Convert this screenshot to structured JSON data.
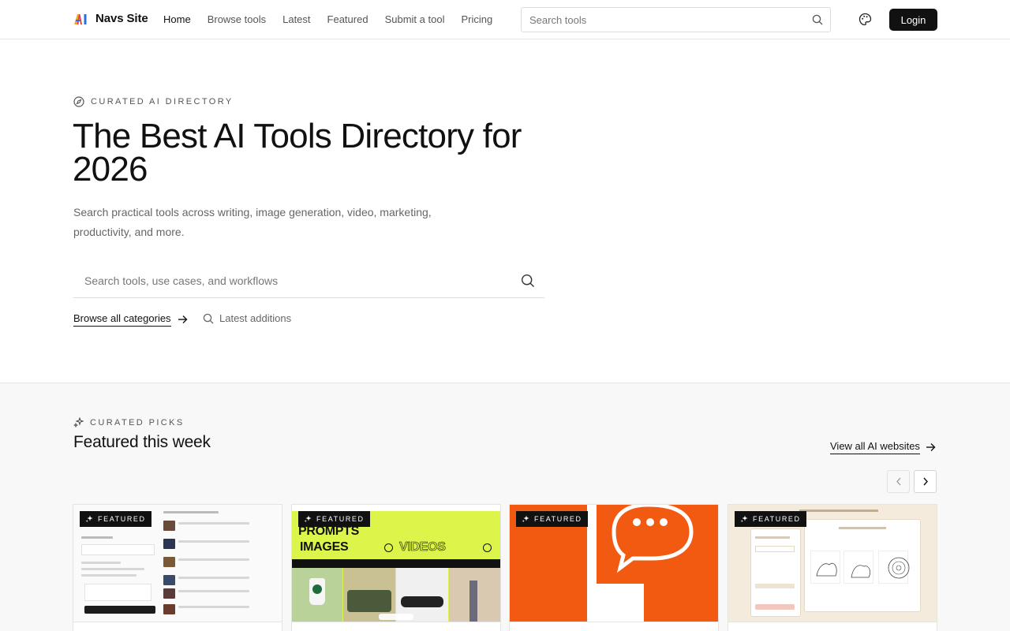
{
  "header": {
    "logo_text": "Navs Site",
    "nav": [
      "Home",
      "Browse tools",
      "Latest",
      "Featured",
      "Submit a tool",
      "Pricing"
    ],
    "active_nav": "Home",
    "search_placeholder": "Search tools",
    "login_label": "Login"
  },
  "hero": {
    "eyebrow": "CURATED AI DIRECTORY",
    "title": "The Best AI Tools Directory for 2026",
    "subtitle": "Search practical tools across writing, image generation, video, marketing, productivity, and more.",
    "search_placeholder": "Search tools, use cases, and workflows",
    "browse_label": "Browse all categories",
    "latest_label": "Latest additions"
  },
  "featured": {
    "eyebrow": "CURATED PICKS",
    "title": "Featured this week",
    "view_all_label": "View all AI websites",
    "cards": [
      {
        "badge": "FEATURED",
        "preview": "music-generator-ui"
      },
      {
        "badge": "FEATURED",
        "preview": "prompts-images-videos",
        "words": [
          "PROMPTS",
          "IMAGES",
          "VIDEOS"
        ]
      },
      {
        "badge": "FEATURED",
        "preview": "orange-chat-logo"
      },
      {
        "badge": "FEATURED",
        "preview": "coloring-page-generator"
      }
    ]
  },
  "colors": {
    "accent": "#111111",
    "lime": "#ddf54a",
    "orange": "#f25a12"
  },
  "icons": {
    "search": "search-icon",
    "palette": "palette-icon",
    "compass": "compass-icon",
    "sparkles": "sparkles-icon",
    "arrow_right": "arrow-right-icon",
    "chevron_left": "chevron-left-icon",
    "chevron_right": "chevron-right-icon"
  }
}
